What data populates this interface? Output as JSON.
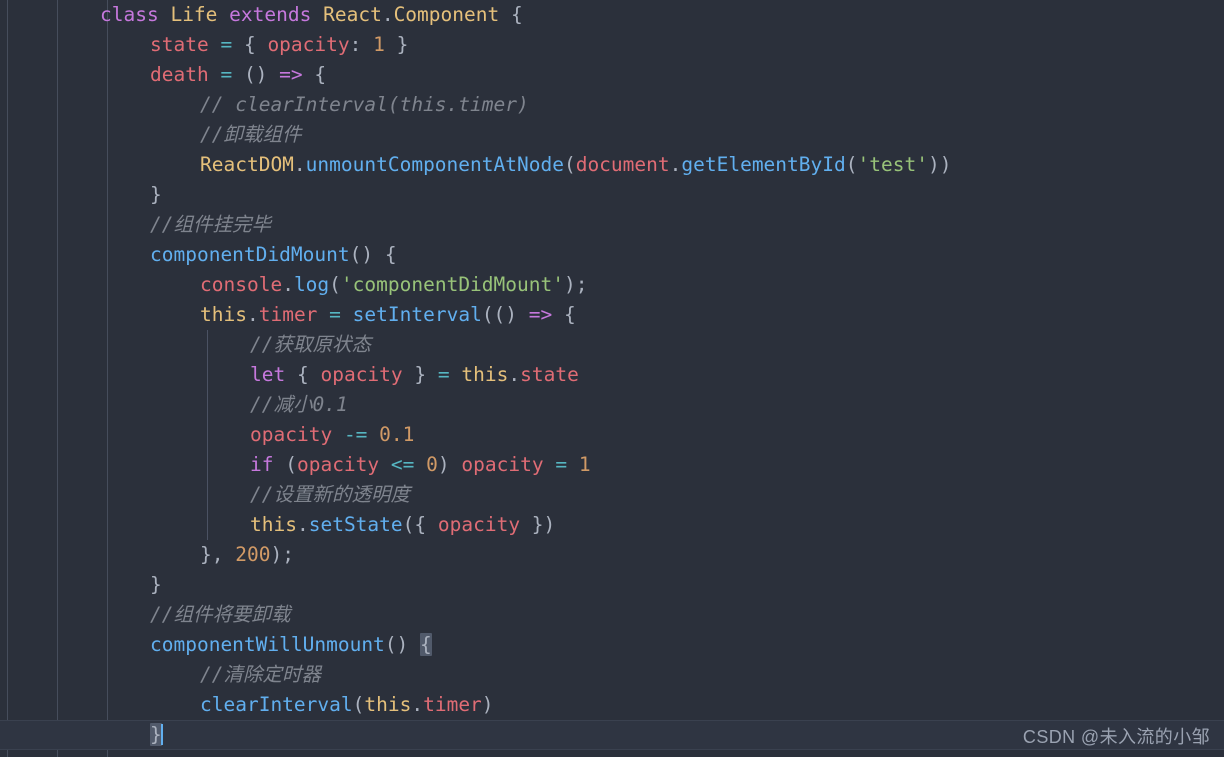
{
  "editor": {
    "background": "#2b303b",
    "indent_rails_x": [
      7,
      57,
      107,
      157
    ],
    "theme_colors": {
      "keyword": "#c678dd",
      "class": "#e5c07b",
      "property": "#e06c75",
      "function": "#61afef",
      "string": "#98c379",
      "number": "#d19a66",
      "operator": "#56b6c2",
      "punctuation": "#abb2bf",
      "comment": "#7f848e",
      "bracket_match": "#515a6b",
      "caret": "#61afef",
      "current_line": "#2f3542"
    }
  },
  "code": {
    "language": "javascript",
    "lines": [
      {
        "n": 1,
        "indent": 0,
        "tokens": [
          {
            "t": "class",
            "c": "kw"
          },
          {
            "t": " ",
            "c": "punc"
          },
          {
            "t": "Life",
            "c": "cls"
          },
          {
            "t": " ",
            "c": "punc"
          },
          {
            "t": "extends",
            "c": "kw"
          },
          {
            "t": " ",
            "c": "punc"
          },
          {
            "t": "React",
            "c": "cls"
          },
          {
            "t": ".",
            "c": "punc"
          },
          {
            "t": "Component",
            "c": "cls"
          },
          {
            "t": " {",
            "c": "punc"
          }
        ]
      },
      {
        "n": 2,
        "indent": 1,
        "tokens": [
          {
            "t": "state",
            "c": "prop"
          },
          {
            "t": " ",
            "c": "punc"
          },
          {
            "t": "=",
            "c": "op"
          },
          {
            "t": " { ",
            "c": "punc"
          },
          {
            "t": "opacity",
            "c": "prop"
          },
          {
            "t": ": ",
            "c": "punc"
          },
          {
            "t": "1",
            "c": "num"
          },
          {
            "t": " }",
            "c": "punc"
          }
        ]
      },
      {
        "n": 3,
        "indent": 1,
        "tokens": [
          {
            "t": "death",
            "c": "prop"
          },
          {
            "t": " ",
            "c": "punc"
          },
          {
            "t": "=",
            "c": "op"
          },
          {
            "t": " () ",
            "c": "punc"
          },
          {
            "t": "=>",
            "c": "kw"
          },
          {
            "t": " {",
            "c": "punc"
          }
        ]
      },
      {
        "n": 4,
        "indent": 2,
        "tokens": [
          {
            "t": "// clearInterval(this.timer)",
            "c": "cmt"
          }
        ]
      },
      {
        "n": 5,
        "indent": 2,
        "tokens": [
          {
            "t": "//卸载组件",
            "c": "cmt"
          }
        ]
      },
      {
        "n": 6,
        "indent": 2,
        "tokens": [
          {
            "t": "ReactDOM",
            "c": "cls"
          },
          {
            "t": ".",
            "c": "punc"
          },
          {
            "t": "unmountComponentAtNode",
            "c": "fn"
          },
          {
            "t": "(",
            "c": "punc"
          },
          {
            "t": "document",
            "c": "prop"
          },
          {
            "t": ".",
            "c": "punc"
          },
          {
            "t": "getElementById",
            "c": "fn"
          },
          {
            "t": "(",
            "c": "punc"
          },
          {
            "t": "'test'",
            "c": "str"
          },
          {
            "t": "))",
            "c": "punc"
          }
        ]
      },
      {
        "n": 7,
        "indent": 1,
        "tokens": [
          {
            "t": "}",
            "c": "punc"
          }
        ]
      },
      {
        "n": 8,
        "indent": 1,
        "tokens": [
          {
            "t": "//组件挂完毕",
            "c": "cmt"
          }
        ]
      },
      {
        "n": 9,
        "indent": 1,
        "tokens": [
          {
            "t": "componentDidMount",
            "c": "fn"
          },
          {
            "t": "() {",
            "c": "punc"
          }
        ]
      },
      {
        "n": 10,
        "indent": 2,
        "tokens": [
          {
            "t": "console",
            "c": "prop"
          },
          {
            "t": ".",
            "c": "punc"
          },
          {
            "t": "log",
            "c": "fn"
          },
          {
            "t": "(",
            "c": "punc"
          },
          {
            "t": "'componentDidMount'",
            "c": "str"
          },
          {
            "t": ");",
            "c": "punc"
          }
        ]
      },
      {
        "n": 11,
        "indent": 2,
        "tokens": [
          {
            "t": "this",
            "c": "cls"
          },
          {
            "t": ".",
            "c": "punc"
          },
          {
            "t": "timer",
            "c": "prop"
          },
          {
            "t": " ",
            "c": "punc"
          },
          {
            "t": "=",
            "c": "op"
          },
          {
            "t": " ",
            "c": "punc"
          },
          {
            "t": "setInterval",
            "c": "fn"
          },
          {
            "t": "(() ",
            "c": "punc"
          },
          {
            "t": "=>",
            "c": "kw"
          },
          {
            "t": " {",
            "c": "punc"
          }
        ]
      },
      {
        "n": 12,
        "indent": 3,
        "tokens": [
          {
            "t": "//获取原状态",
            "c": "cmt"
          }
        ]
      },
      {
        "n": 13,
        "indent": 3,
        "tokens": [
          {
            "t": "let",
            "c": "kw"
          },
          {
            "t": " { ",
            "c": "punc"
          },
          {
            "t": "opacity",
            "c": "prop"
          },
          {
            "t": " } ",
            "c": "punc"
          },
          {
            "t": "=",
            "c": "op"
          },
          {
            "t": " ",
            "c": "punc"
          },
          {
            "t": "this",
            "c": "cls"
          },
          {
            "t": ".",
            "c": "punc"
          },
          {
            "t": "state",
            "c": "prop"
          }
        ]
      },
      {
        "n": 14,
        "indent": 3,
        "tokens": [
          {
            "t": "//减小0.1",
            "c": "cmt"
          }
        ]
      },
      {
        "n": 15,
        "indent": 3,
        "tokens": [
          {
            "t": "opacity",
            "c": "prop"
          },
          {
            "t": " ",
            "c": "punc"
          },
          {
            "t": "-=",
            "c": "op"
          },
          {
            "t": " ",
            "c": "punc"
          },
          {
            "t": "0.1",
            "c": "num"
          }
        ]
      },
      {
        "n": 16,
        "indent": 3,
        "tokens": [
          {
            "t": "if",
            "c": "kw"
          },
          {
            "t": " (",
            "c": "punc"
          },
          {
            "t": "opacity",
            "c": "prop"
          },
          {
            "t": " ",
            "c": "punc"
          },
          {
            "t": "<=",
            "c": "op"
          },
          {
            "t": " ",
            "c": "punc"
          },
          {
            "t": "0",
            "c": "num"
          },
          {
            "t": ") ",
            "c": "punc"
          },
          {
            "t": "opacity",
            "c": "prop"
          },
          {
            "t": " ",
            "c": "punc"
          },
          {
            "t": "=",
            "c": "op"
          },
          {
            "t": " ",
            "c": "punc"
          },
          {
            "t": "1",
            "c": "num"
          }
        ]
      },
      {
        "n": 17,
        "indent": 3,
        "tokens": [
          {
            "t": "//设置新的透明度",
            "c": "cmt"
          }
        ]
      },
      {
        "n": 18,
        "indent": 3,
        "tokens": [
          {
            "t": "this",
            "c": "cls"
          },
          {
            "t": ".",
            "c": "punc"
          },
          {
            "t": "setState",
            "c": "fn"
          },
          {
            "t": "({ ",
            "c": "punc"
          },
          {
            "t": "opacity",
            "c": "prop"
          },
          {
            "t": " })",
            "c": "punc"
          }
        ]
      },
      {
        "n": 19,
        "indent": 2,
        "tokens": [
          {
            "t": "}, ",
            "c": "punc"
          },
          {
            "t": "200",
            "c": "num"
          },
          {
            "t": ");",
            "c": "punc"
          }
        ]
      },
      {
        "n": 20,
        "indent": 1,
        "tokens": [
          {
            "t": "}",
            "c": "punc"
          }
        ]
      },
      {
        "n": 21,
        "indent": 1,
        "tokens": [
          {
            "t": "//组件将要卸载",
            "c": "cmt"
          }
        ]
      },
      {
        "n": 22,
        "indent": 1,
        "tokens": [
          {
            "t": "componentWillUnmount",
            "c": "fn"
          },
          {
            "t": "() ",
            "c": "punc"
          },
          {
            "t": "{",
            "c": "punc",
            "match": true
          }
        ]
      },
      {
        "n": 23,
        "indent": 2,
        "tokens": [
          {
            "t": "//清除定时器",
            "c": "cmt"
          }
        ]
      },
      {
        "n": 24,
        "indent": 2,
        "tokens": [
          {
            "t": "clearInterval",
            "c": "fn"
          },
          {
            "t": "(",
            "c": "punc"
          },
          {
            "t": "this",
            "c": "cls"
          },
          {
            "t": ".",
            "c": "punc"
          },
          {
            "t": "timer",
            "c": "prop"
          },
          {
            "t": ")",
            "c": "punc"
          }
        ]
      },
      {
        "n": 25,
        "indent": 1,
        "current": true,
        "caret": true,
        "tokens": [
          {
            "t": "}",
            "c": "punc",
            "match": true
          }
        ]
      }
    ]
  },
  "watermark": {
    "text": "CSDN @未入流的小邹"
  }
}
